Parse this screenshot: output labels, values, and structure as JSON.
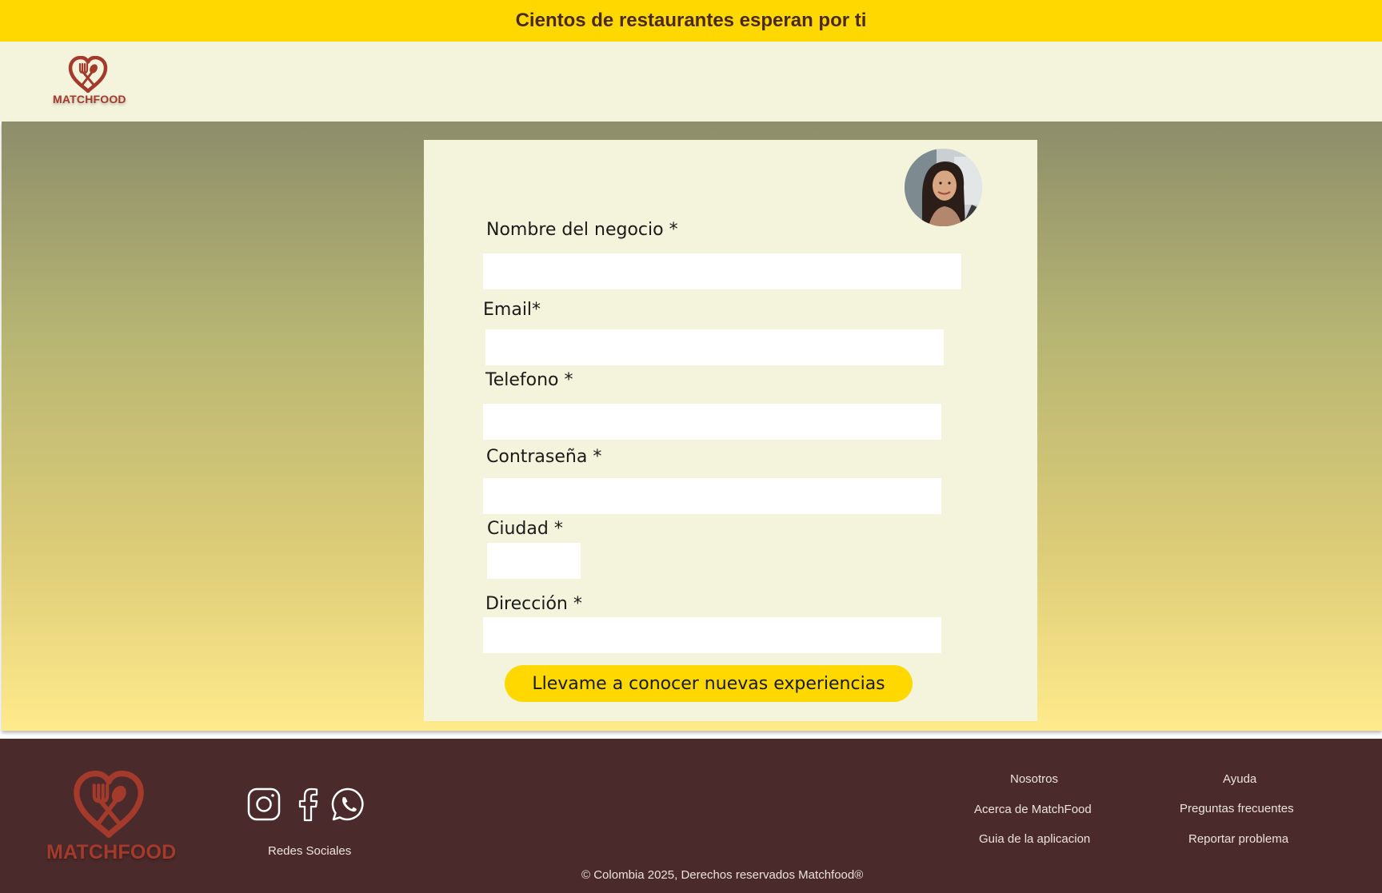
{
  "banner": {
    "text": "Cientos de restaurantes esperan por ti"
  },
  "brand": {
    "name": "MATCHFOOD",
    "logo_icon": "heart-fork-spoon-icon",
    "primary_color": "#A33A2C",
    "accent_color": "#FFD800"
  },
  "form": {
    "business_name_label": "Nombre del negocio *",
    "business_name_value": "",
    "email_label": "Email*",
    "email_value": "",
    "phone_label": "Telefono *",
    "phone_value": "",
    "password_label": "Contraseña *",
    "password_value": "",
    "city_label": "Ciudad *",
    "city_value": "",
    "address_label": "Dirección *",
    "address_value": "",
    "submit_label": "Llevame a conocer nuevas experiencias"
  },
  "footer": {
    "social_label": "Redes Sociales",
    "social_icons": [
      "instagram-icon",
      "facebook-icon",
      "whatsapp-icon"
    ],
    "col1": {
      "title": "Nosotros",
      "links": [
        "Acerca de MatchFood",
        "Guia de la aplicacion"
      ]
    },
    "col2": {
      "title": "Ayuda",
      "links": [
        "Preguntas frecuentes",
        "Reportar problema"
      ]
    },
    "copyright": "© Colombia 2025, Derechos reservados Matchfood®",
    "background_color": "#4A2A2A"
  }
}
